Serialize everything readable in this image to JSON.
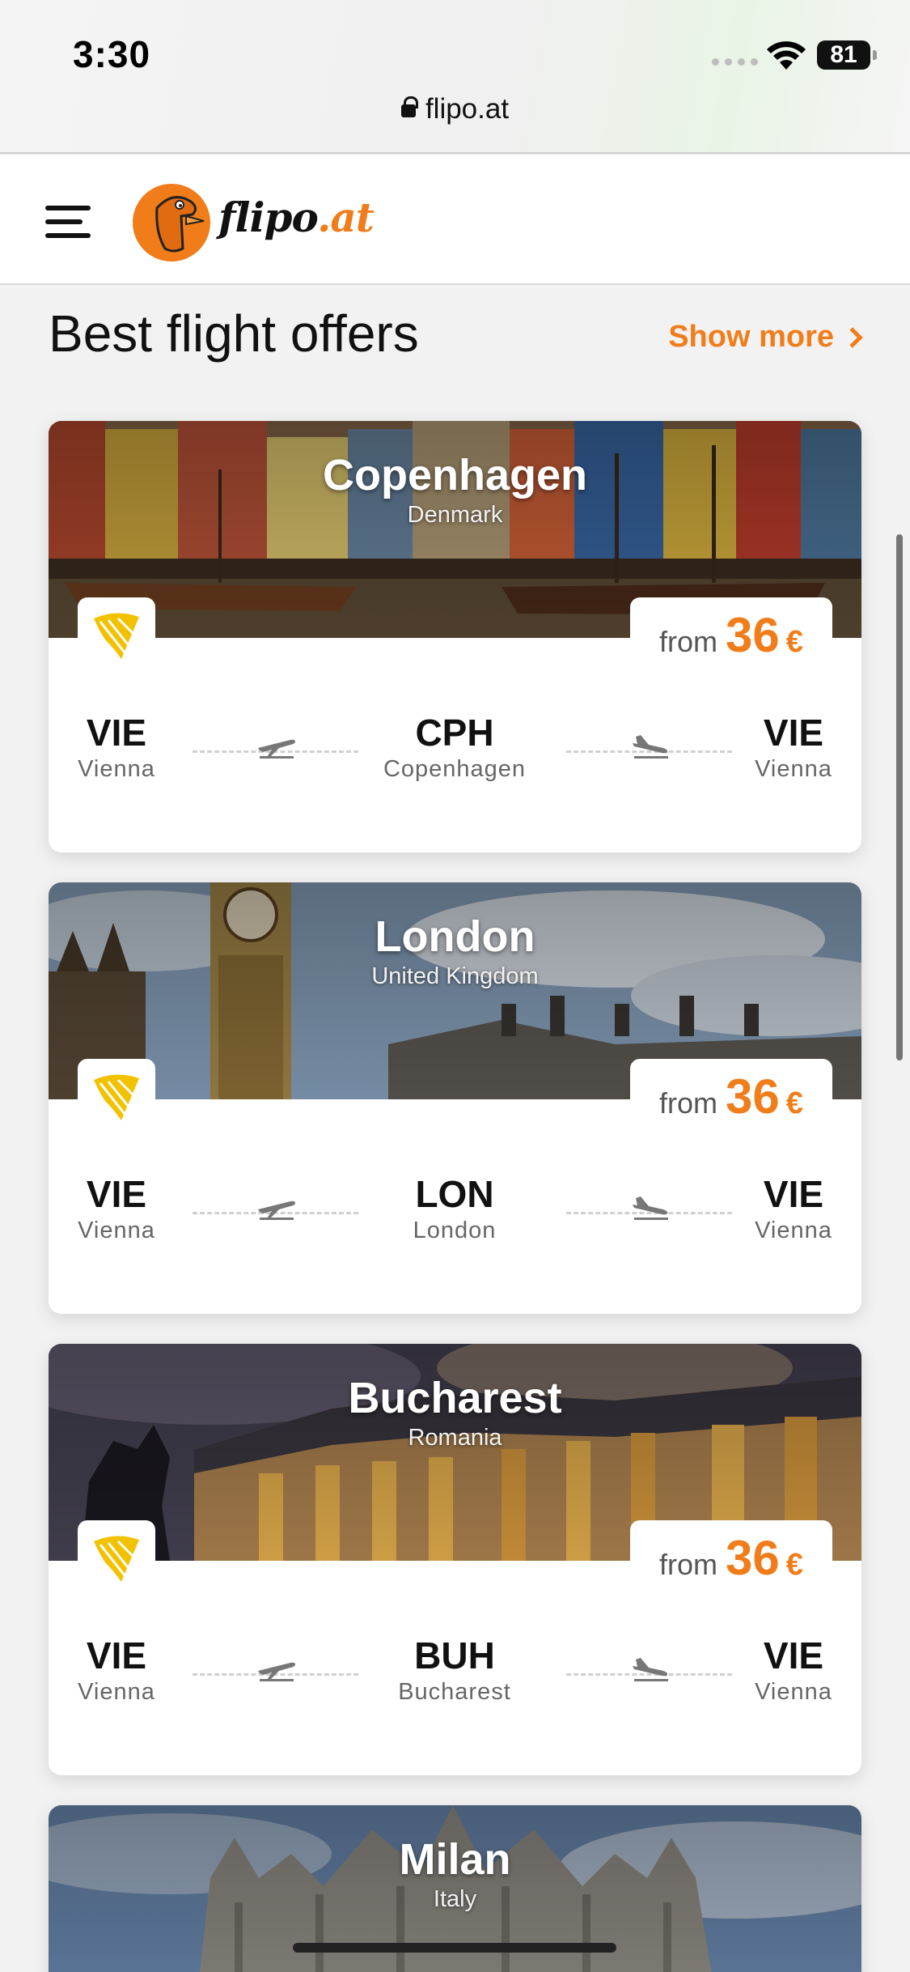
{
  "status": {
    "time": "3:30",
    "battery": "81",
    "url": "flipo.at"
  },
  "header": {
    "logo_name": "flipo",
    "logo_tld": ".at"
  },
  "section": {
    "title": "Best flight offers",
    "show_more": "Show more"
  },
  "cards": [
    {
      "city": "Copenhagen",
      "country": "Denmark",
      "price_from": "from",
      "price": "36",
      "currency": "€",
      "route": [
        {
          "code": "VIE",
          "name": "Vienna"
        },
        {
          "code": "CPH",
          "name": "Copenhagen"
        },
        {
          "code": "VIE",
          "name": "Vienna"
        }
      ]
    },
    {
      "city": "London",
      "country": "United Kingdom",
      "price_from": "from",
      "price": "36",
      "currency": "€",
      "route": [
        {
          "code": "VIE",
          "name": "Vienna"
        },
        {
          "code": "LON",
          "name": "London"
        },
        {
          "code": "VIE",
          "name": "Vienna"
        }
      ]
    },
    {
      "city": "Bucharest",
      "country": "Romania",
      "price_from": "from",
      "price": "36",
      "currency": "€",
      "route": [
        {
          "code": "VIE",
          "name": "Vienna"
        },
        {
          "code": "BUH",
          "name": "Bucharest"
        },
        {
          "code": "VIE",
          "name": "Vienna"
        }
      ]
    },
    {
      "city": "Milan",
      "country": "Italy"
    }
  ],
  "colors": {
    "accent": "#f07d1a",
    "airline": "#f2c200"
  }
}
